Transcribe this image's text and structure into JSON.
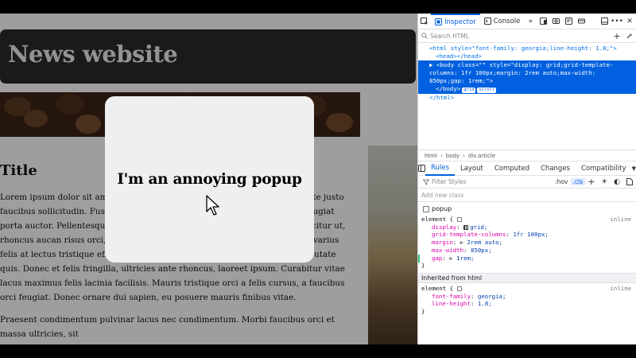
{
  "page": {
    "site_title": "News website",
    "article_title": "Title",
    "paragraphs": [
      "Lorem ipsum dolor sit amet, consectetur adipiscing elit. Curabitur vulputate justo faucibus sollicitudin. Fusce ut odio sed mauris tincidunt velit. Curabitur feugiat porta auctor. Pellentesque nunc. Ut ut ornare felis. Morbi quam tellus, efficitur ut, rhoncus aucan risus orci, luctus vitae interdum eget, gravida id sapien. In varius felis at lectus tristique efficitur. Sed cursus nunc odio, ac vulputate ex vulputate quis. Donec et felis fringilla, ultricies ante rhoncus, laoreet ipsum. Curabitur vitae lacus maximus felis lacinia facilisis. Mauris tristique orci a felis cursus, a faucibus orci feugiat. Donec ornare dui sapien, eu posuere mauris finibus vitae.",
      "Praesent condimentum pulvinar lacus nec condimentum. Morbi faucibus orci et massa ultricies, sit"
    ],
    "popup_text": "I'm an annoying popup"
  },
  "devtools": {
    "tabs": {
      "inspector": "Inspector",
      "console": "Console"
    },
    "search_placeholder": "Search HTML",
    "markup": {
      "line1": "<html style=\"font-family: georgia;line-height: 1.8;\">",
      "line2": "<head></head>",
      "selected": "<body class=\"\" style=\"display: grid;grid-template-columns: 1fr 100px;margin: 2rem auto;max-width: 850px;gap: 1rem;\">",
      "selected_end": "</body>",
      "badge_grid": "grid",
      "badge_scroll": "scroll",
      "line_end": "</html>"
    },
    "breadcrumbs": [
      "html",
      "body",
      "div.article"
    ],
    "rules_tabs": [
      "Rules",
      "Layout",
      "Computed",
      "Changes",
      "Compatibility"
    ],
    "filter_placeholder": "Filter Styles",
    "hov": ":hov",
    "cls": ".cls",
    "add_class_placeholder": "Add new class",
    "class_checkbox": "popup",
    "rule1": {
      "selector": "element {",
      "source": "inline",
      "decls": [
        {
          "prop": "display",
          "val": "grid;"
        },
        {
          "prop": "grid-template-columns",
          "val": "1fr 100px;"
        },
        {
          "prop": "margin",
          "val": "2rem auto;"
        },
        {
          "prop": "max-width",
          "val": "850px;"
        },
        {
          "prop": "gap",
          "val": "1rem;"
        }
      ],
      "close": "}"
    },
    "inherited_header": "Inherited from html",
    "rule2": {
      "selector": "element {",
      "source": "inline",
      "decls": [
        {
          "prop": "font-family",
          "val": "georgia;"
        },
        {
          "prop": "line-height",
          "val": "1.8;"
        }
      ],
      "close": "}"
    }
  },
  "colors": {
    "accent": "#0060df",
    "header_bg": "#2b2b2f",
    "popup_bg": "#efefef"
  }
}
